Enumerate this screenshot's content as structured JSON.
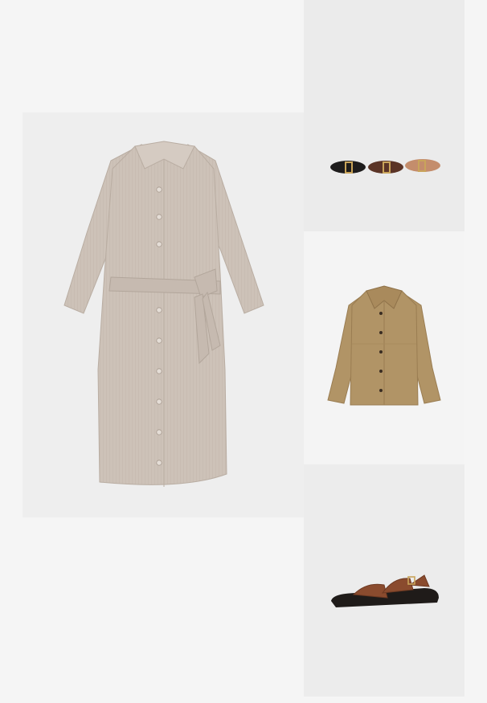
{
  "outfit": {
    "items": [
      {
        "id": "dress",
        "kind": "linen shirt dress with tie belt",
        "colors": {
          "base": "#cdc2b8",
          "shade": "#b9ada2",
          "button": "#e4ddd6"
        }
      },
      {
        "id": "belts",
        "kind": "set of three belts",
        "colors": {
          "black": "#1e1c1c",
          "brown": "#5b3426",
          "tan": "#c48d6c",
          "buckle": "#c9a45a"
        }
      },
      {
        "id": "jacket",
        "kind": "suede shirt jacket",
        "colors": {
          "base": "#b19466",
          "shade": "#9a7d52",
          "button": "#3a2d22"
        }
      },
      {
        "id": "sandal",
        "kind": "leather strap sandal",
        "colors": {
          "strap": "#8a4b2e",
          "sole": "#1f1b19",
          "buckle": "#c9a45a"
        }
      }
    ]
  }
}
